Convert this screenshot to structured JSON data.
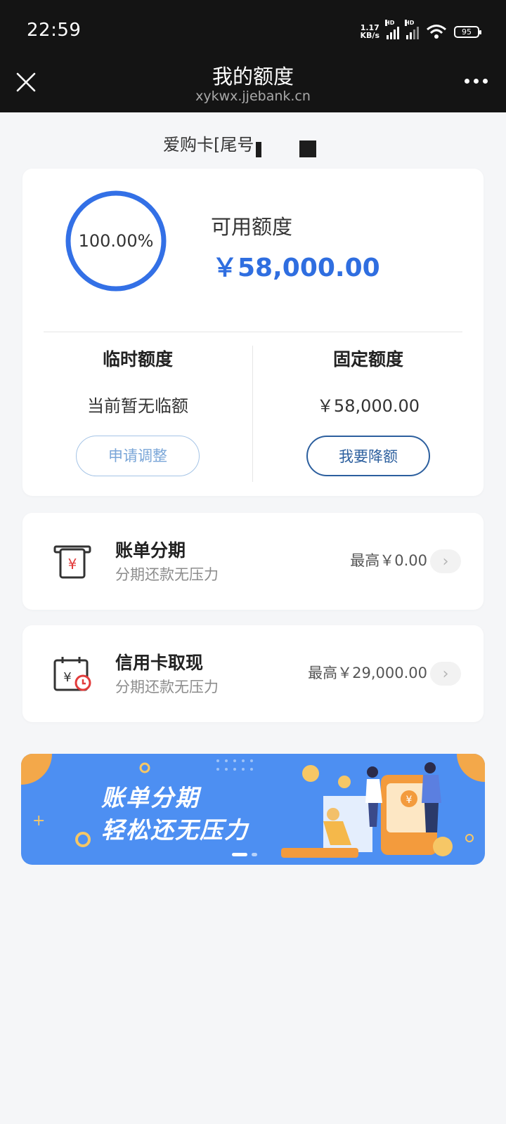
{
  "status_bar": {
    "time": "22:59",
    "net_speed_value": "1.17",
    "net_speed_unit": "KB/s",
    "signal_tag": "HD",
    "battery": "95"
  },
  "nav": {
    "title": "我的额度",
    "url": "xykwx.jjebank.cn",
    "close_icon": "close-icon",
    "more_icon": "more-icon"
  },
  "card": {
    "name": "爱购卡[尾号"
  },
  "quota": {
    "percent_text": "100.00%",
    "percent_value": 100,
    "available_label": "可用额度",
    "available_amount": "￥58,000.00",
    "temporary": {
      "title": "临时额度",
      "value": "当前暂无临额",
      "button": "申请调整"
    },
    "fixed": {
      "title": "固定额度",
      "value": "￥58,000.00",
      "button": "我要降额"
    }
  },
  "services": [
    {
      "title": "账单分期",
      "subtitle": "分期还款无压力",
      "max": "最高￥0.00",
      "icon": "installment-icon"
    },
    {
      "title": "信用卡取现",
      "subtitle": "分期还款无压力",
      "max": "最高￥29,000.00",
      "icon": "cash-advance-icon"
    }
  ],
  "banner": {
    "line1": "账单分期",
    "line2": "轻松还无压力"
  },
  "colors": {
    "accent": "#2f6ee0",
    "ring": "#3370e6",
    "header_bg": "#141414",
    "page_bg": "#f5f6f8",
    "banner_bg": "#4d8ff2",
    "icon_red": "#e23b3b"
  }
}
